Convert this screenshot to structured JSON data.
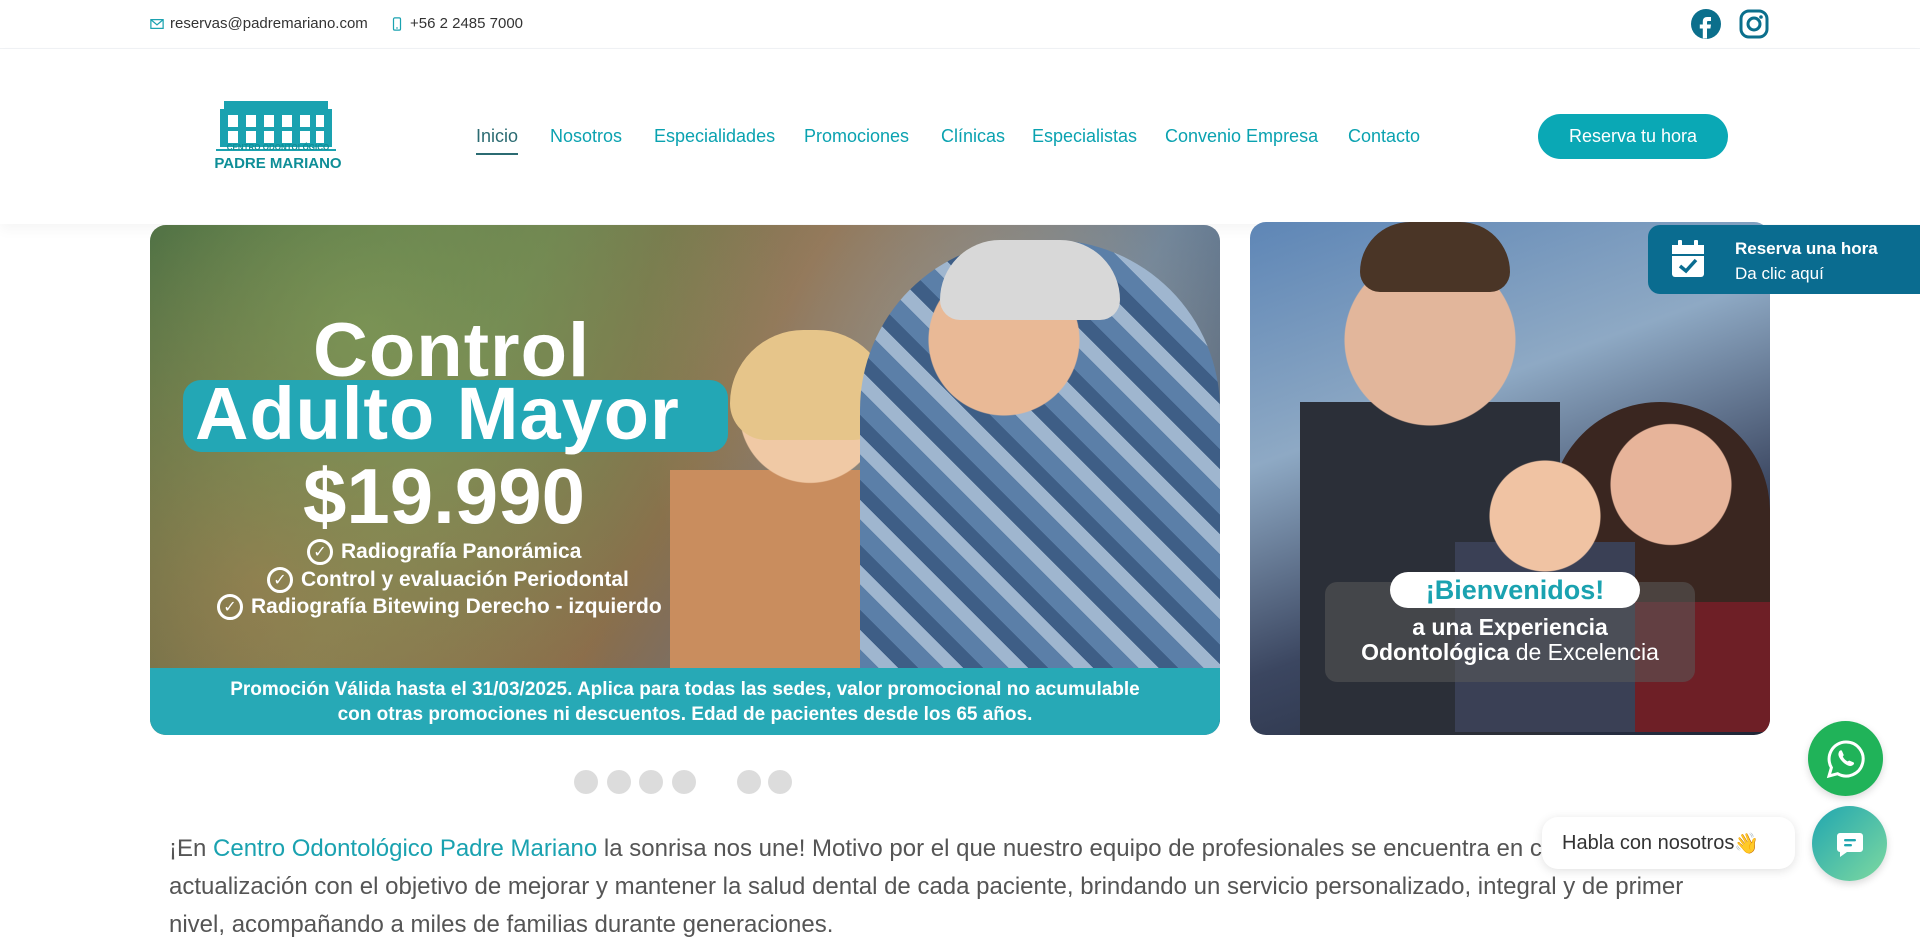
{
  "topbar": {
    "email": "reservas@padremariano.com",
    "phone": "+56 2 2485 7000",
    "social": [
      "facebook-icon",
      "instagram-icon"
    ]
  },
  "logo": {
    "line1": "CENTRO ODONTOLÓGICO",
    "line2": "PADRE MARIANO"
  },
  "nav": {
    "items": [
      {
        "label": "Inicio",
        "active": true
      },
      {
        "label": "Nosotros"
      },
      {
        "label": "Especialidades"
      },
      {
        "label": "Promociones"
      },
      {
        "label": "Clínicas"
      },
      {
        "label": "Especialistas"
      },
      {
        "label": "Convenio Empresa"
      },
      {
        "label": "Contacto"
      }
    ],
    "cta": "Reserva tu hora"
  },
  "hero": {
    "main": {
      "title1": "Control",
      "title2": "Adulto Mayor",
      "price": "$19.990",
      "checks": [
        "Radiografía Panorámica",
        "Control y evaluación Periodontal",
        "Radiografía Bitewing Derecho - izquierdo"
      ],
      "footer_line1": "Promoción Válida hasta el 31/03/2025. Aplica para todas las sedes, valor promocional no acumulable",
      "footer_line2": "con otras promociones ni descuentos. Edad de pacientes desde los 65 años."
    },
    "side": {
      "pill": "¡Bienvenidos!",
      "line1": "a una Experiencia",
      "line2_bold": "Odontológica",
      "line2_rest": " de Excelencia"
    },
    "dots_count": 6
  },
  "float_reserva": {
    "title": "Reserva una hora",
    "subtitle": "Da clic aquí"
  },
  "intro": {
    "before": "¡En ",
    "highlight": "Centro Odontológico Padre Mariano",
    "after": " la sonrisa nos une! Motivo por el que nuestro equipo de profesionales se encuentra en constante actualización con el objetivo de mejorar y mantener la salud dental de cada paciente, brindando un servicio personalizado, integral y de primer nivel, acompañando a miles de familias durante generaciones."
  },
  "chat": {
    "bubble": "Habla con nosotros",
    "emoji": "👋"
  },
  "colors": {
    "brand": "#0aa8b5",
    "nav_text": "#0aa2b0",
    "float_tab": "#0a6c90",
    "whatsapp": "#20b359"
  }
}
